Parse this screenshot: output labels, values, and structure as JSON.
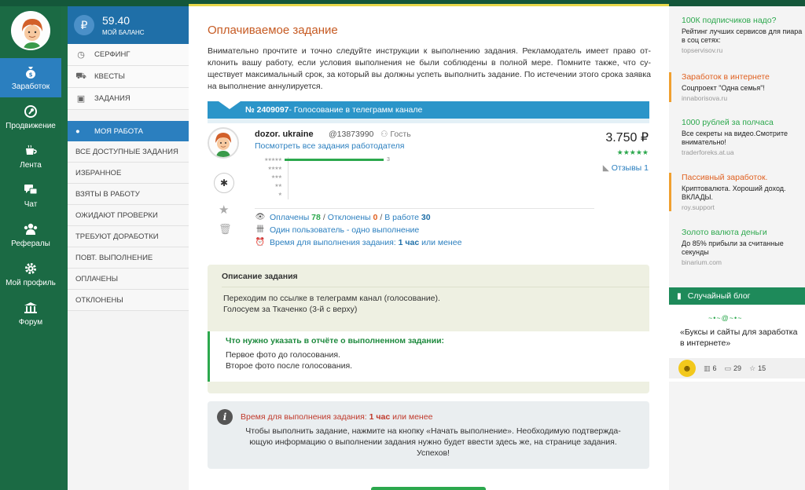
{
  "balance": {
    "amount": "59.40",
    "label": "МОЙ БАЛАНС",
    "currency_symbol": "₽"
  },
  "leftnav": {
    "items": [
      {
        "label": "Заработок",
        "icon": "money-bag-icon"
      },
      {
        "label": "Продвижение",
        "icon": "rocket-icon"
      },
      {
        "label": "Лента",
        "icon": "cup-icon"
      },
      {
        "label": "Чат",
        "icon": "chat-icon"
      },
      {
        "label": "Рефералы",
        "icon": "users-icon"
      },
      {
        "label": "Мой профиль",
        "icon": "gear-icon"
      },
      {
        "label": "Форум",
        "icon": "bank-icon"
      }
    ]
  },
  "submenu": {
    "items": [
      "СЕРФИНГ",
      "КВЕСТЫ",
      "ЗАДАНИЯ"
    ],
    "section_title": "МОЯ РАБОТА",
    "sub_items": [
      "ВСЕ ДОСТУПНЫЕ ЗАДАНИЯ",
      "ИЗБРАННОЕ",
      "ВЗЯТЫ В РАБОТУ",
      "ОЖИДАЮТ ПРОВЕРКИ",
      "ТРЕБУЮТ ДОРАБОТКИ",
      "ПОВТ. ВЫПОЛНЕНИЕ",
      "ОПЛАЧЕНЫ",
      "ОТКЛОНЕНЫ"
    ]
  },
  "main": {
    "title": "Оплачиваемое задание",
    "intro": "Внимательно прочтите и точно следуйте инструкции к выполнению задания. Рекламодатель имеет право от-клонить вашу работу, если условия выполнения не были соблюдены в полной мере. Помните также, что су-ществует максимальный срок, за который вы должны успеть выполнить задание. По истечении этого срока заявка на выполнение аннулируется.",
    "task_number": "№ 2409097",
    "task_name": " - Голосование в телеграмм канале",
    "advertiser": {
      "name": "dozor. ukraine",
      "id": "@13873990",
      "status": "Гость",
      "link": "Посмотреть все задания работодателя"
    },
    "price": "3.750 ₽",
    "price_stars": "★★★★★",
    "reviews": "Отзывы 1",
    "rating_breakdown": [
      {
        "stars": "★★★★★",
        "count": "3",
        "fraction": 1.0
      },
      {
        "stars": "★★★★",
        "count": "",
        "fraction": 0
      },
      {
        "stars": "★★★",
        "count": "",
        "fraction": 0
      },
      {
        "stars": "★★",
        "count": "",
        "fraction": 0
      },
      {
        "stars": "★",
        "count": "",
        "fraction": 0
      }
    ],
    "stats": {
      "paid_label": "Оплачены",
      "paid": "78",
      "rejected_label": "Отклонены",
      "rejected": "0",
      "inwork_label": "В работе",
      "inwork": "30",
      "one_user": "Один пользователь - одно выполнение",
      "time_label": "Время для выполнения задания:",
      "time_value": "1 час",
      "time_suffix": "или менее"
    },
    "description": {
      "title": "Описание задания",
      "lines": [
        "Переходим по ссылке в телеграмм канал (голосование).",
        "Голосуем за Ткаченко (3-й с верху)"
      ]
    },
    "report": {
      "title": "Что нужно указать в отчёте о выполненном задании:",
      "lines": [
        "Первое фото до голосования.",
        "Второе фото после голосования."
      ]
    },
    "info": {
      "time_label": "Время для выполнения задания:",
      "time_value": "1 час",
      "time_suffix": "или менее",
      "text": "Чтобы выполнить задание, нажмите на кнопку «Начать выполнение». Необходимую подтвержда-ющую информацию о выполнении задания нужно будет ввести здесь же, на странице задания. Успехов!"
    }
  },
  "rightbar": {
    "ads": [
      {
        "title": "100К подписчиков надо?",
        "text": "Рейтинг лучших сервисов для пиара в соц сетях:",
        "url": "topservisov.ru",
        "accent": false
      },
      {
        "title": "Заработок в интернете",
        "text": "Соцпроект \"Одна семья\"!",
        "url": "innaborisova.ru",
        "accent": true
      },
      {
        "title": "1000 рублей за полчаса",
        "text": "Все секреты на видео.Смотрите внимательно!",
        "url": "traderforeks.at.ua",
        "accent": false
      },
      {
        "title": "Пассивный заработок.",
        "text": "Криптовалюта. Хороший доход. ВКЛАДЫ.",
        "url": "roy.support",
        "accent": true
      },
      {
        "title": "Золото валюта деньги",
        "text": "До 85% прибыли за считанные секунды",
        "url": "binarium.com",
        "accent": false
      }
    ],
    "blog_head": "Случайный блог",
    "blog_title": "«Буксы и сайты для заработка в интернете»",
    "blog_stats": {
      "posts": "6",
      "comments": "29",
      "likes": "15"
    }
  },
  "colors": {
    "nav_bg": "#1b6a44",
    "accent_blue": "#2b7fbf",
    "green": "#2ca84d",
    "orange": "#e06020"
  }
}
